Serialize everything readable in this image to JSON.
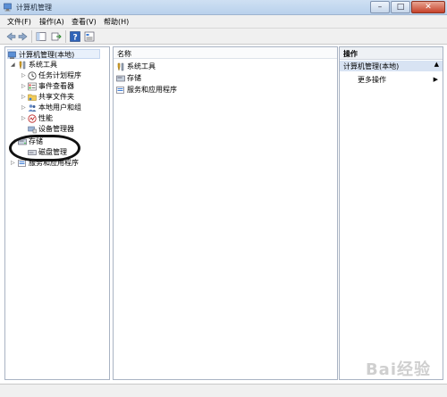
{
  "window": {
    "title": "计算机管理"
  },
  "menu": [
    "文件(F)",
    "操作(A)",
    "查看(V)",
    "帮助(H)"
  ],
  "tree": {
    "root": "计算机管理(本地)",
    "system_tools": "系统工具",
    "task_scheduler": "任务计划程序",
    "event_viewer": "事件查看器",
    "shared_folders": "共享文件夹",
    "local_users": "本地用户和组",
    "performance": "性能",
    "device_manager": "设备管理器",
    "storage": "存储",
    "disk_management": "磁盘管理",
    "services_apps": "服务和应用程序"
  },
  "center": {
    "column_name": "名称",
    "items": [
      "系统工具",
      "存储",
      "服务和应用程序"
    ]
  },
  "actions": {
    "header": "操作",
    "section_title": "计算机管理(本地)",
    "more_actions": "更多操作"
  },
  "watermark": "Bai经验"
}
